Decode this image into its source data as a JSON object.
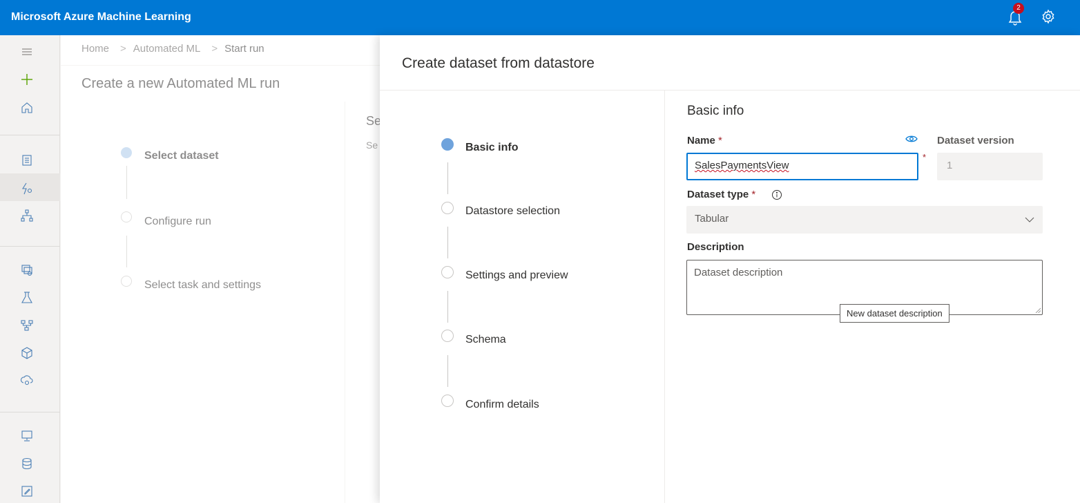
{
  "app": {
    "title": "Microsoft Azure Machine Learning",
    "notification_count": "2"
  },
  "breadcrumb": {
    "home": "Home",
    "automated_ml": "Automated ML",
    "current": "Start run"
  },
  "background": {
    "page_title": "Create a new Automated ML run",
    "peek_title": "Se",
    "peek_subtitle": "Se",
    "steps": [
      {
        "label": "Select dataset",
        "state": "active"
      },
      {
        "label": "Configure run",
        "state": "pending"
      },
      {
        "label": "Select task and settings",
        "state": "pending"
      }
    ]
  },
  "panel": {
    "title": "Create dataset from datastore",
    "steps": [
      {
        "label": "Basic info",
        "state": "active"
      },
      {
        "label": "Datastore selection",
        "state": "pending"
      },
      {
        "label": "Settings and preview",
        "state": "pending"
      },
      {
        "label": "Schema",
        "state": "pending"
      },
      {
        "label": "Confirm details",
        "state": "pending"
      }
    ],
    "form": {
      "section_title": "Basic info",
      "name_label": "Name",
      "required_mark": "*",
      "name_value": "SalesPaymentsView",
      "version_label": "Dataset version",
      "version_value": "1",
      "type_label": "Dataset type",
      "type_value": "Tabular",
      "description_label": "Description",
      "description_placeholder": "Dataset description",
      "tooltip": "New dataset description"
    }
  },
  "nav_icons": [
    "menu-icon",
    "add-icon",
    "home-icon",
    "notebooks-icon",
    "automated-ml-icon",
    "designer-icon",
    "datasets-icon",
    "experiments-icon",
    "pipelines-icon",
    "models-icon",
    "endpoints-icon",
    "compute-icon",
    "datastores-icon",
    "labeling-icon"
  ],
  "colors": {
    "brand": "#0078d4",
    "required": "#a4262c",
    "badge": "#c50f1f",
    "active_step": "#6fa3dc"
  }
}
